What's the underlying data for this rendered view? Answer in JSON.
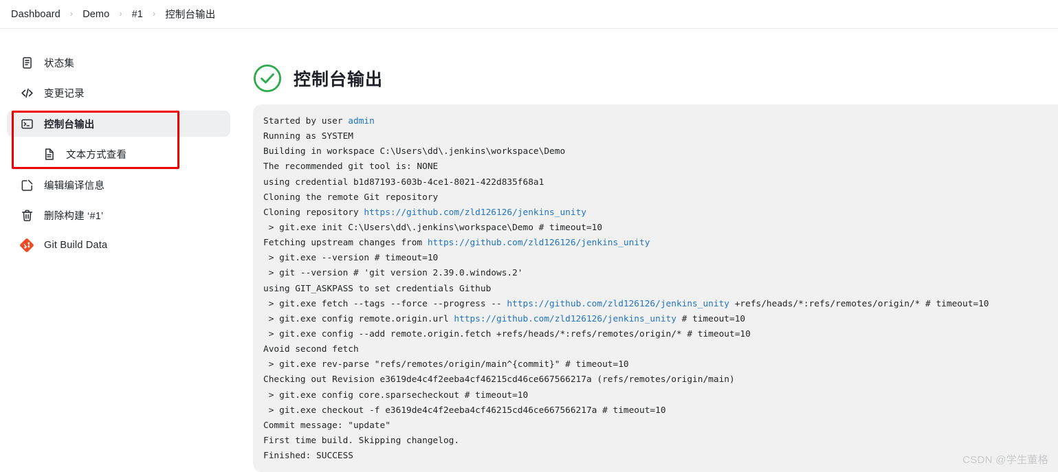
{
  "breadcrumb": {
    "separator": "›",
    "items": [
      {
        "label": "Dashboard"
      },
      {
        "label": "Demo"
      },
      {
        "label": "#1"
      },
      {
        "label": "控制台输出"
      }
    ]
  },
  "sidebar": {
    "items": [
      {
        "label": "状态集",
        "icon": "document-list-icon"
      },
      {
        "label": "变更记录",
        "icon": "code-brackets-icon"
      },
      {
        "label": "控制台输出",
        "icon": "terminal-icon"
      },
      {
        "label": "文本方式查看",
        "icon": "text-file-icon"
      },
      {
        "label": "编辑编译信息",
        "icon": "edit-square-icon"
      },
      {
        "label": "删除构建 ‘#1’",
        "icon": "trash-icon"
      },
      {
        "label": "Git Build Data",
        "icon": "git-diamond-icon"
      }
    ]
  },
  "main": {
    "title": "控制台输出",
    "status": "success",
    "status_color": "#2cab4b"
  },
  "console": {
    "link_color": "#1f74c4",
    "lines": [
      [
        {
          "t": "Started by user "
        },
        {
          "t": "admin",
          "link": true
        }
      ],
      [
        {
          "t": "Running as SYSTEM"
        }
      ],
      [
        {
          "t": "Building in workspace C:\\Users\\dd\\.jenkins\\workspace\\Demo"
        }
      ],
      [
        {
          "t": "The recommended git tool is: NONE"
        }
      ],
      [
        {
          "t": "using credential b1d87193-603b-4ce1-8021-422d835f68a1"
        }
      ],
      [
        {
          "t": "Cloning the remote Git repository"
        }
      ],
      [
        {
          "t": "Cloning repository "
        },
        {
          "t": "https://github.com/zld126126/jenkins_unity",
          "link": true
        }
      ],
      [
        {
          "t": " > git.exe init C:\\Users\\dd\\.jenkins\\workspace\\Demo # timeout=10"
        }
      ],
      [
        {
          "t": "Fetching upstream changes from "
        },
        {
          "t": "https://github.com/zld126126/jenkins_unity",
          "link": true
        }
      ],
      [
        {
          "t": " > git.exe --version # timeout=10"
        }
      ],
      [
        {
          "t": " > git --version # 'git version 2.39.0.windows.2'"
        }
      ],
      [
        {
          "t": "using GIT_ASKPASS to set credentials Github"
        }
      ],
      [
        {
          "t": " > git.exe fetch --tags --force --progress -- "
        },
        {
          "t": "https://github.com/zld126126/jenkins_unity",
          "link": true
        },
        {
          "t": " +refs/heads/*:refs/remotes/origin/* # timeout=10"
        }
      ],
      [
        {
          "t": " > git.exe config remote.origin.url "
        },
        {
          "t": "https://github.com/zld126126/jenkins_unity",
          "link": true
        },
        {
          "t": " # timeout=10"
        }
      ],
      [
        {
          "t": " > git.exe config --add remote.origin.fetch +refs/heads/*:refs/remotes/origin/* # timeout=10"
        }
      ],
      [
        {
          "t": "Avoid second fetch"
        }
      ],
      [
        {
          "t": " > git.exe rev-parse \"refs/remotes/origin/main^{commit}\" # timeout=10"
        }
      ],
      [
        {
          "t": "Checking out Revision e3619de4c4f2eeba4cf46215cd46ce667566217a (refs/remotes/origin/main)"
        }
      ],
      [
        {
          "t": " > git.exe config core.sparsecheckout # timeout=10"
        }
      ],
      [
        {
          "t": " > git.exe checkout -f e3619de4c4f2eeba4cf46215cd46ce667566217a # timeout=10"
        }
      ],
      [
        {
          "t": "Commit message: \"update\""
        }
      ],
      [
        {
          "t": "First time build. Skipping changelog."
        }
      ],
      [
        {
          "t": "Finished: SUCCESS"
        }
      ]
    ]
  },
  "watermark": {
    "text": "CSDN @学生董格"
  }
}
